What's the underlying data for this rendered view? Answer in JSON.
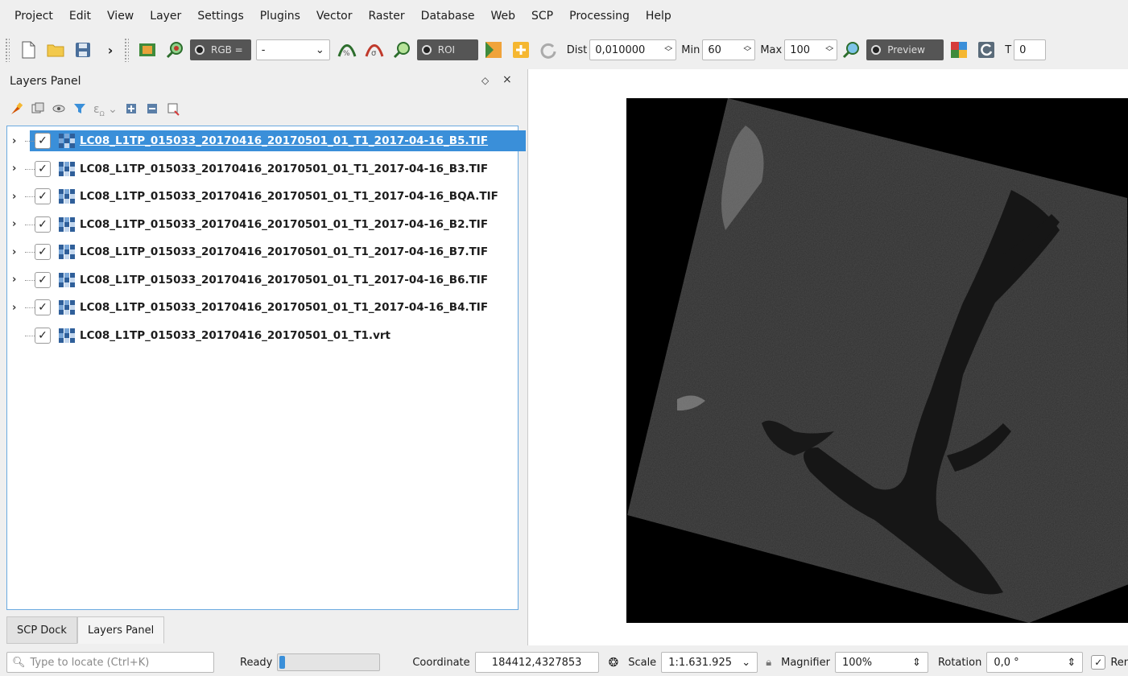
{
  "menu": [
    "Project",
    "Edit",
    "View",
    "Layer",
    "Settings",
    "Plugins",
    "Vector",
    "Raster",
    "Database",
    "Web",
    "SCP",
    "Processing",
    "Help"
  ],
  "toolbar": {
    "rgb_label": "RGB =",
    "rgb_value": "-",
    "roi_label": "ROI",
    "dist_label": "Dist",
    "dist_value": "0,010000",
    "min_label": "Min",
    "min_value": "60",
    "max_label": "Max",
    "max_value": "100",
    "preview_label": "Preview",
    "t_label": "T",
    "t_value": "0"
  },
  "layers_panel": {
    "title": "Layers Panel",
    "float_glyph": "◇",
    "close_glyph": "×",
    "layers": [
      {
        "name": "LC08_L1TP_015033_20170416_20170501_01_T1_2017-04-16_B5.TIF",
        "checked": true,
        "selected": true,
        "expandable": true
      },
      {
        "name": "LC08_L1TP_015033_20170416_20170501_01_T1_2017-04-16_B3.TIF",
        "checked": true,
        "selected": false,
        "expandable": true
      },
      {
        "name": "LC08_L1TP_015033_20170416_20170501_01_T1_2017-04-16_BQA.TIF",
        "checked": true,
        "selected": false,
        "expandable": true
      },
      {
        "name": "LC08_L1TP_015033_20170416_20170501_01_T1_2017-04-16_B2.TIF",
        "checked": true,
        "selected": false,
        "expandable": true
      },
      {
        "name": "LC08_L1TP_015033_20170416_20170501_01_T1_2017-04-16_B7.TIF",
        "checked": true,
        "selected": false,
        "expandable": true
      },
      {
        "name": "LC08_L1TP_015033_20170416_20170501_01_T1_2017-04-16_B6.TIF",
        "checked": true,
        "selected": false,
        "expandable": true
      },
      {
        "name": "LC08_L1TP_015033_20170416_20170501_01_T1_2017-04-16_B4.TIF",
        "checked": true,
        "selected": false,
        "expandable": true
      },
      {
        "name": "LC08_L1TP_015033_20170416_20170501_01_T1.vrt",
        "checked": true,
        "selected": false,
        "expandable": false
      }
    ]
  },
  "tabs": [
    "SCP Dock",
    "Layers Panel"
  ],
  "statusbar": {
    "locator_placeholder": "Type to locate (Ctrl+K)",
    "ready_label": "Ready",
    "progress": 0.05,
    "coordinate_label": "Coordinate",
    "coordinate_value": "184412,4327853",
    "scale_label": "Scale",
    "scale_value": "1:1.631.925",
    "magnifier_label": "Magnifier",
    "magnifier_value": "100%",
    "rotation_label": "Rotation",
    "rotation_value": "0,0 °",
    "render_label": "Rend"
  },
  "colors": {
    "selection": "#3a8fd9",
    "raster_icon": "#2f5f9a",
    "scene_land": "#2c2c2c",
    "scene_water": "#161616"
  }
}
